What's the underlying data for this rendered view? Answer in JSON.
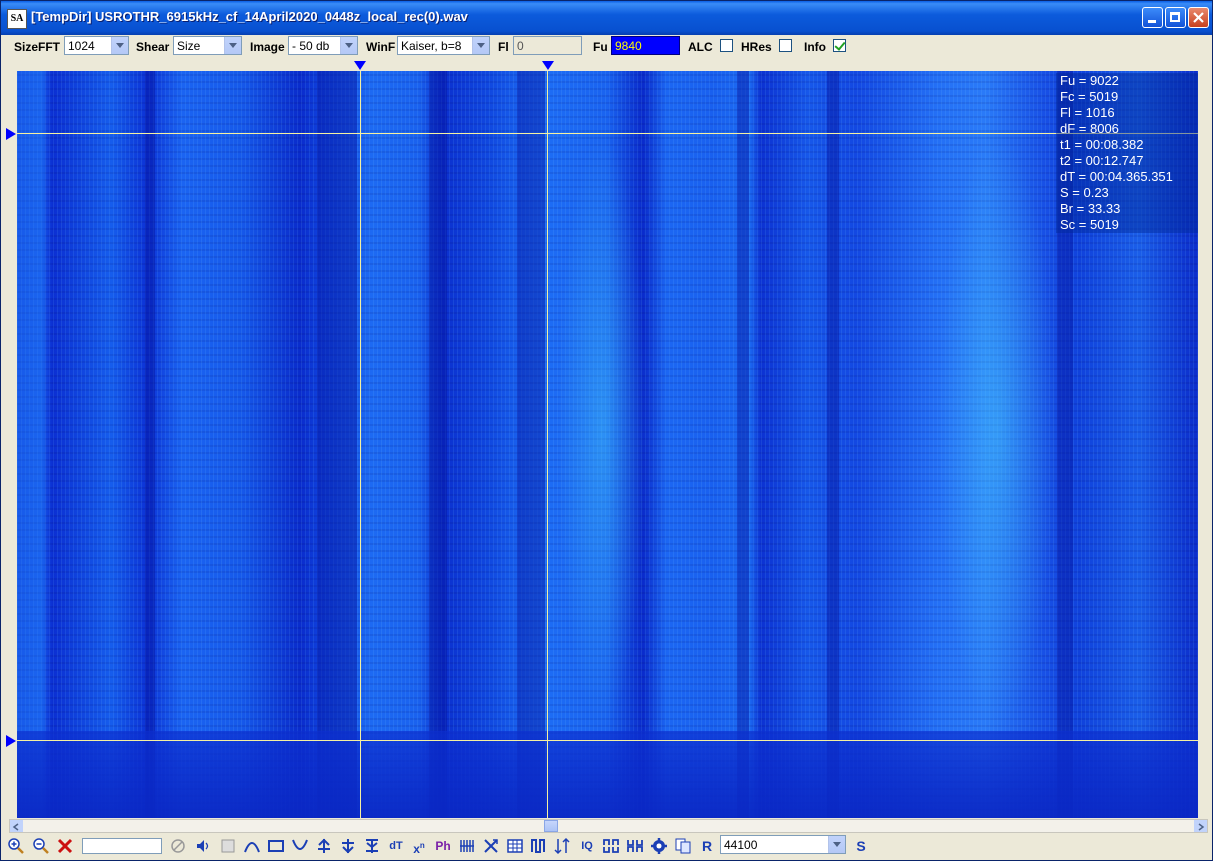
{
  "window": {
    "icon_text": "SA",
    "title": "[TempDir] USROTHR_6915kHz_cf_14April2020_0448z_local_rec(0).wav"
  },
  "toolbar": {
    "sizefft_label": "SizeFFT",
    "sizefft_value": "1024",
    "shear_label": "Shear",
    "shear_value": "Size",
    "image_label": "Image",
    "image_value": "- 50 db",
    "winf_label": "WinF",
    "winf_value": "Kaiser, b=8",
    "fl_label": "Fl",
    "fl_value": "0",
    "fu_label": "Fu",
    "fu_value": "9840",
    "alc_label": "ALC",
    "alc_checked": false,
    "hres_label": "HRes",
    "hres_checked": false,
    "info_label": "Info",
    "info_checked": true
  },
  "info_panel": [
    "Fu = 9022",
    "Fc = 5019",
    "Fl = 1016",
    "dF = 8006",
    "t1 = 00:08.382",
    "t2 = 00:12.747",
    "dT = 00:04.365.351",
    "S = 0.23",
    "Br = 33.33",
    "Sc = 5019"
  ],
  "bottom_toolbar": {
    "sample_rate": "44100",
    "tools": [
      "zoom-in-icon",
      "zoom-out-icon",
      "delete-icon",
      "no-icon",
      "speaker-icon",
      "stop-icon",
      "arc-up-icon",
      "rectangle-icon",
      "arc-down-icon",
      "tool-a-icon",
      "tool-b-icon",
      "tool-c-icon",
      "dt-icon",
      "xn-icon",
      "ph-icon",
      "comb-icon",
      "cross-icon",
      "grid-icon",
      "pulse-icon",
      "up-down-icon",
      "iq-icon",
      "pattern-a-icon",
      "pattern-b-icon",
      "gear-icon",
      "copy-icon",
      "r-icon"
    ],
    "dt_text": "dT",
    "xn_text": "x",
    "ph_text": "Ph",
    "iq_text": "IQ",
    "r_text": "R",
    "s_text": "S"
  }
}
